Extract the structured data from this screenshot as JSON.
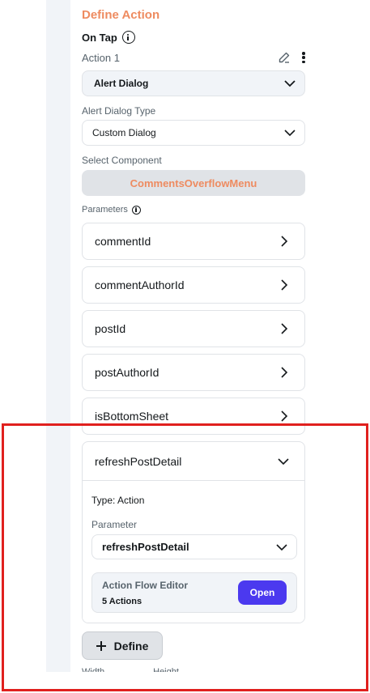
{
  "panel": {
    "title": "Define Action",
    "trigger": "On Tap",
    "action_label": "Action 1",
    "action_type_value": "Alert Dialog",
    "alert_dialog_type_label": "Alert Dialog Type",
    "alert_dialog_type_value": "Custom Dialog",
    "select_component_label": "Select Component",
    "component_name": "CommentsOverflowMenu",
    "parameters_label": "Parameters",
    "parameters": [
      {
        "name": "commentId"
      },
      {
        "name": "commentAuthorId"
      },
      {
        "name": "postId"
      },
      {
        "name": "postAuthorId"
      },
      {
        "name": "isBottomSheet"
      }
    ],
    "expanded_parameter": {
      "name": "refreshPostDetail",
      "type_text": "Type: Action",
      "parameter_label": "Parameter",
      "parameter_value": "refreshPostDetail",
      "flow_editor_title": "Action Flow Editor",
      "flow_editor_count": "5 Actions",
      "open_label": "Open"
    },
    "define_label": "Define",
    "bottom_partial": [
      "Width",
      "Height"
    ]
  },
  "colors": {
    "accent_orange": "#ee8b60",
    "primary_button": "#4b39ef",
    "highlight_red": "#e0201e"
  }
}
